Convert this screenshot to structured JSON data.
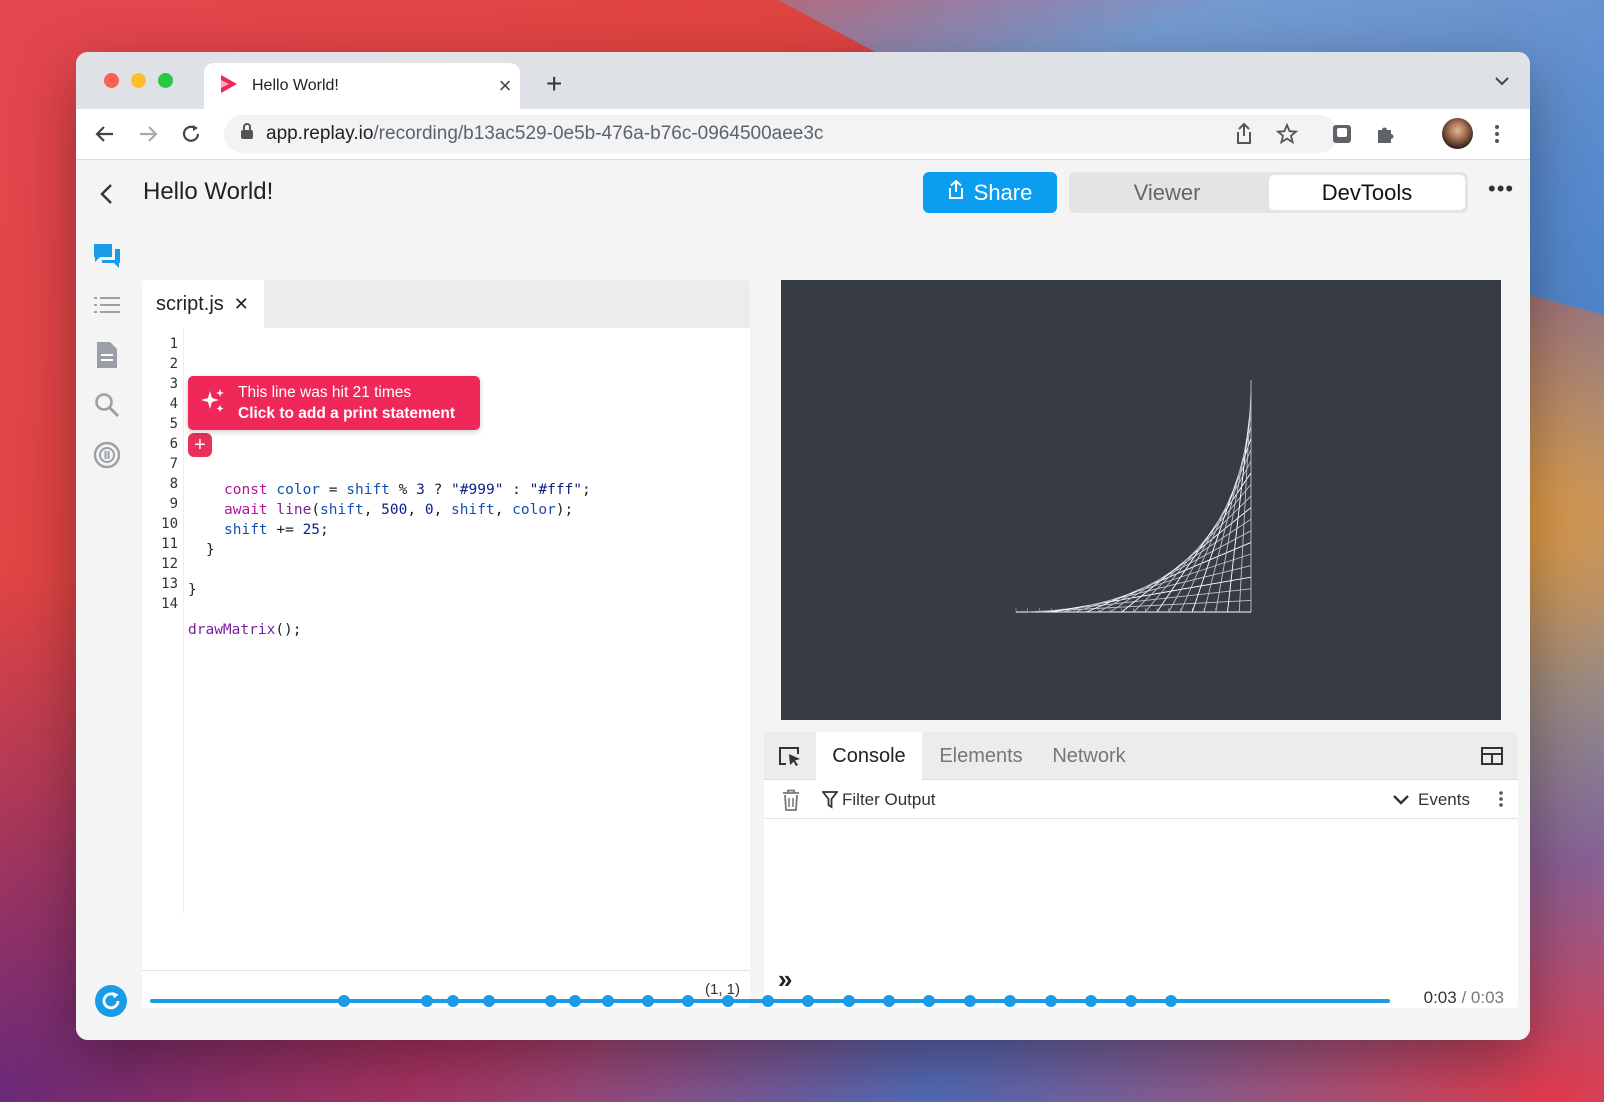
{
  "browser": {
    "tab_title": "Hello World!",
    "url_host": "app.replay.io",
    "url_path": "/recording/b13ac529-0e5b-476a-b76c-0964500aee3c"
  },
  "header": {
    "title": "Hello World!",
    "share_label": "Share",
    "viewer_label": "Viewer",
    "devtools_label": "DevTools",
    "active_mode": "DevTools"
  },
  "sidebar": {
    "icons": [
      "comments-icon",
      "events-list-icon",
      "source-file-icon",
      "search-icon",
      "replay-info-icon"
    ]
  },
  "editor": {
    "tab_label": "script.js",
    "tab_close": "✕",
    "line_numbers": [
      "1",
      "2",
      "3",
      "4",
      "5",
      "6",
      "7",
      "8",
      "9",
      "10",
      "11",
      "12",
      "13",
      "14"
    ],
    "tooltip_line1": "This line was hit 21 times",
    "tooltip_line2": "Click to add a print statement",
    "cursor_position": "(1, 1)"
  },
  "devtools": {
    "tabs": [
      "Console",
      "Elements",
      "Network"
    ],
    "active_tab": "Console",
    "filter_placeholder": "Filter Output",
    "events_label": "Events",
    "prompt": "»"
  },
  "timeline": {
    "current_time": "0:03",
    "separator": "/",
    "total_time": "0:03",
    "progress": 1.0
  },
  "colors": {
    "accent": "#0a9df0",
    "tooltip": "#f0285a",
    "canvas_bg": "#363b45"
  }
}
